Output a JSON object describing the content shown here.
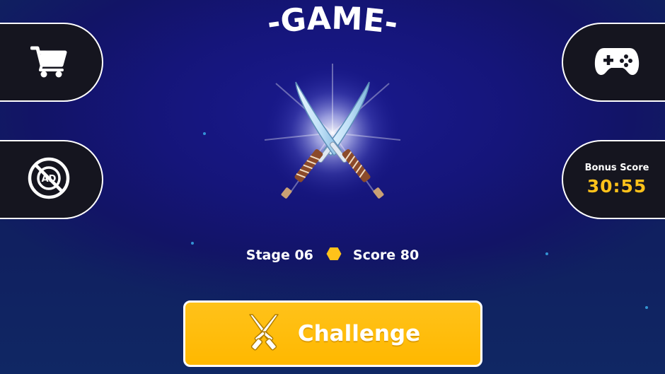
{
  "title": "-GAME-",
  "side_buttons": {
    "shop_icon": "shopping-cart-icon",
    "no_ads_icon": "no-ads-icon",
    "no_ads_text": "AD",
    "games_icon": "gamepad-icon"
  },
  "bonus": {
    "label": "Bonus Score",
    "time": "30:55"
  },
  "stats": {
    "stage": "Stage 06",
    "score": "Score 80"
  },
  "challenge_button": {
    "label": "Challenge",
    "icon": "crossed-swords-icon"
  },
  "colors": {
    "background": "#15157a",
    "panel": "#15151f",
    "accent": "#ffc21a",
    "star": "#3aa8e6"
  }
}
